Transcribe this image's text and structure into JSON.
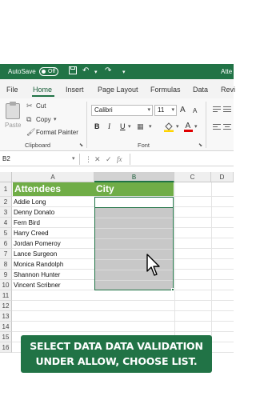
{
  "titlebar": {
    "autosave_label": "AutoSave",
    "autosave_state": "Off",
    "title_fragment": "Atte"
  },
  "ribbon_tabs": [
    "File",
    "Home",
    "Insert",
    "Page Layout",
    "Formulas",
    "Data",
    "Revi"
  ],
  "active_tab": "Home",
  "clipboard": {
    "paste_label": "Paste",
    "cut_label": "Cut",
    "copy_label": "Copy",
    "format_painter_label": "Format Painter",
    "group_label": "Clipboard"
  },
  "font": {
    "name": "Calibri",
    "size": "11",
    "group_label": "Font",
    "bold": "B",
    "italic": "I",
    "underline": "U",
    "grow": "A",
    "shrink": "A"
  },
  "formula_bar": {
    "cell_ref": "B2",
    "fx_label": "fx",
    "cancel_icon": "cross-icon",
    "enter_icon": "check-icon"
  },
  "columns": [
    "A",
    "B",
    "C",
    "D"
  ],
  "rows": [
    "1",
    "2",
    "3",
    "4",
    "5",
    "6",
    "7",
    "8",
    "9",
    "10",
    "11",
    "12",
    "13",
    "14",
    "15",
    "16"
  ],
  "sheet": {
    "header_a": "Attendees",
    "header_b": "City",
    "attendees": [
      "Addie Long",
      "Denny Donato",
      "Fern Bird",
      "Harry Creed",
      "Jordan Pomeroy",
      "Lance Surgeon",
      "Monica Randolph",
      "Shannon Hunter",
      "Vincent Scribner"
    ],
    "header_color": "#70ad47",
    "selection_color": "#217346"
  },
  "caption": {
    "line1": "SELECT DATA DATA VALIDATION",
    "line2": "UNDER ALLOW, CHOOSE LIST."
  },
  "colors": {
    "excel_green": "#217346",
    "header_green": "#70ad47"
  }
}
